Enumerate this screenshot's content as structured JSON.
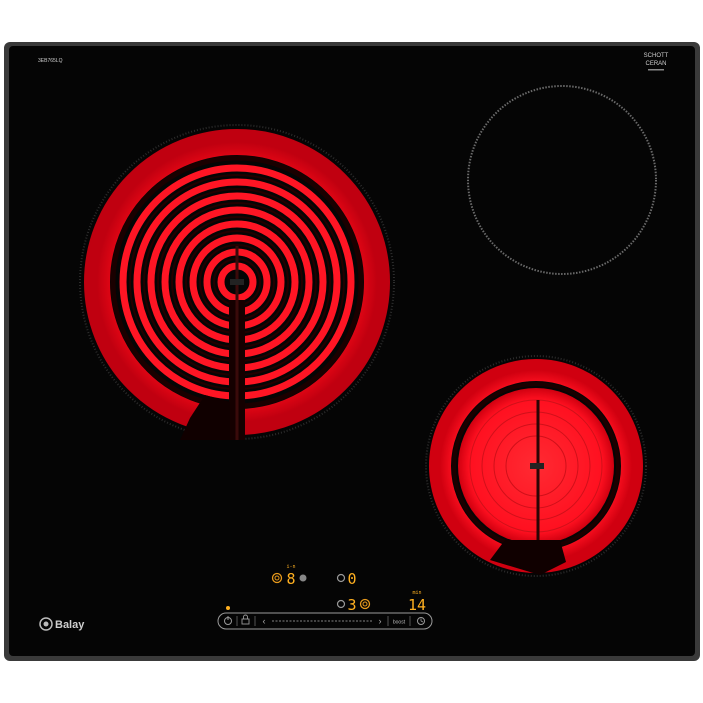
{
  "cooktop": {
    "model_code": "3EB765LQ",
    "glass_brand_line1": "SCHOTT",
    "glass_brand_line2": "CERAN",
    "brand_name": "Balay",
    "colors": {
      "frame": "#3a3a3a",
      "glass": "#050505",
      "element_red": "#ff1020",
      "display_amber": "#ffb020"
    },
    "zones": [
      {
        "name": "large-dual-zone",
        "state": "on"
      },
      {
        "name": "rear-right-zone",
        "state": "off"
      },
      {
        "name": "front-right-dual-zone",
        "state": "on"
      }
    ],
    "displays": {
      "zone_left_level": "8",
      "zone_left_indicator": "i-n",
      "zone_center_level": "0",
      "zone_front_level": "3",
      "timer_value": "14",
      "timer_unit": "min"
    },
    "control_bar": {
      "power_icon": "power-icon",
      "child_lock_icon": "lock-icon",
      "minus_label": "‹",
      "plus_label": "›",
      "boost_label": "boost",
      "timer_icon": "clock-icon"
    }
  }
}
